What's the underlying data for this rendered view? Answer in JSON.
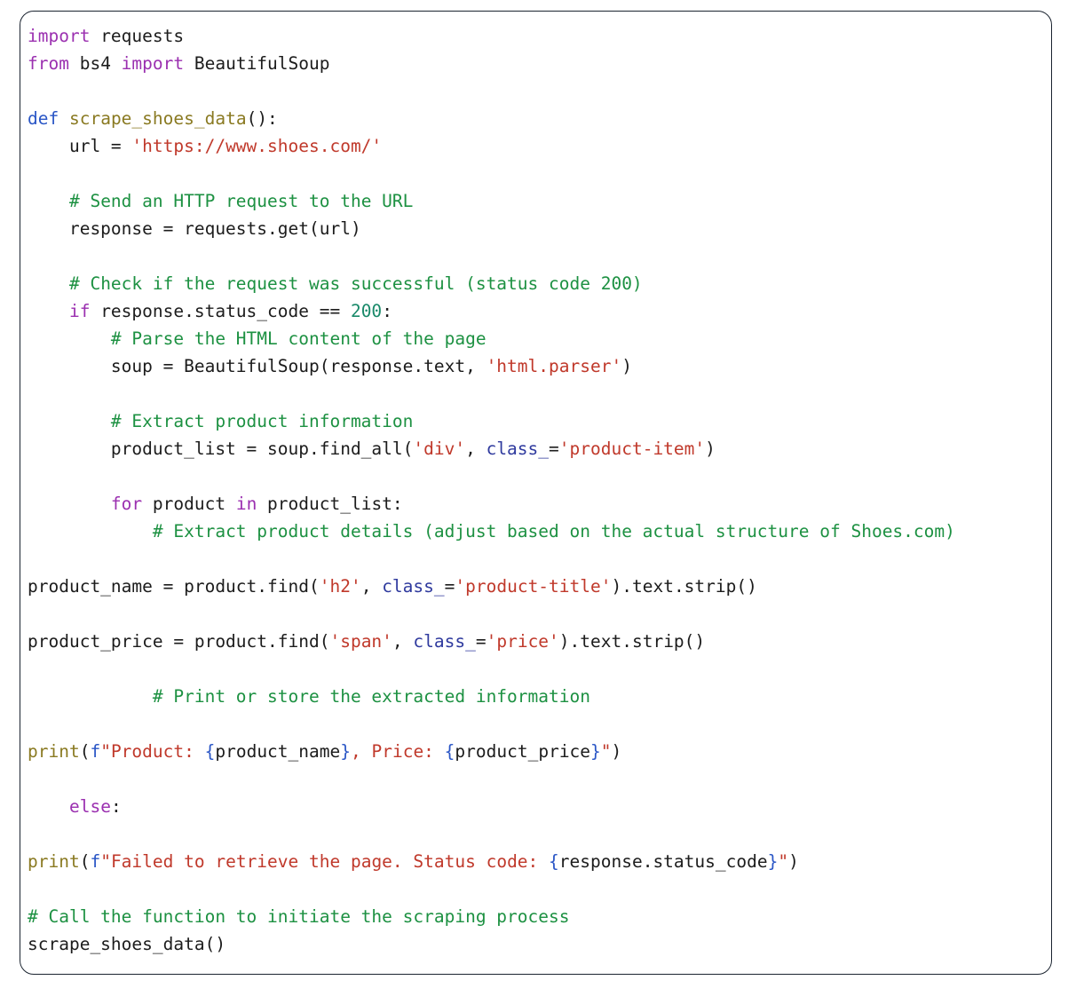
{
  "window": {
    "title": "Python code block",
    "language": "python",
    "border_color": "#1b2430",
    "background_color": "#ffffff"
  },
  "theme": {
    "keyword_color": "#9b30b0",
    "def_keyword_color": "#2a56c6",
    "function_name_color": "#8a7a22",
    "string_color": "#c0392b",
    "number_color": "#1a8a6a",
    "comment_color": "#1d9142",
    "kwarg_color": "#2f3a9e",
    "fstring_brace_color": "#2a56c6",
    "plain_text_color": "#1c1c1c"
  },
  "code": {
    "lines": [
      {
        "n": 1,
        "tokens": [
          {
            "t": "import",
            "c": "kw"
          },
          {
            "t": " requests",
            "c": "plain"
          }
        ]
      },
      {
        "n": 2,
        "tokens": [
          {
            "t": "from",
            "c": "kw"
          },
          {
            "t": " bs4 ",
            "c": "plain"
          },
          {
            "t": "import",
            "c": "kw"
          },
          {
            "t": " BeautifulSoup",
            "c": "plain"
          }
        ]
      },
      {
        "n": 3,
        "tokens": []
      },
      {
        "n": 4,
        "tokens": [
          {
            "t": "def",
            "c": "def"
          },
          {
            "t": " ",
            "c": "plain"
          },
          {
            "t": "scrape_shoes_data",
            "c": "fn"
          },
          {
            "t": "():",
            "c": "plain"
          }
        ]
      },
      {
        "n": 5,
        "tokens": [
          {
            "t": "    url = ",
            "c": "plain"
          },
          {
            "t": "'https://www.shoes.com/'",
            "c": "str"
          }
        ]
      },
      {
        "n": 6,
        "tokens": []
      },
      {
        "n": 7,
        "tokens": [
          {
            "t": "    ",
            "c": "plain"
          },
          {
            "t": "# Send an HTTP request to the URL",
            "c": "cmt"
          }
        ]
      },
      {
        "n": 8,
        "tokens": [
          {
            "t": "    response = requests.get(url)",
            "c": "plain"
          }
        ]
      },
      {
        "n": 9,
        "tokens": []
      },
      {
        "n": 10,
        "tokens": [
          {
            "t": "    ",
            "c": "plain"
          },
          {
            "t": "# Check if the request was successful (status code 200)",
            "c": "cmt"
          }
        ]
      },
      {
        "n": 11,
        "tokens": [
          {
            "t": "    ",
            "c": "plain"
          },
          {
            "t": "if",
            "c": "kw"
          },
          {
            "t": " response.status_code == ",
            "c": "plain"
          },
          {
            "t": "200",
            "c": "num"
          },
          {
            "t": ":",
            "c": "plain"
          }
        ]
      },
      {
        "n": 12,
        "tokens": [
          {
            "t": "        ",
            "c": "plain"
          },
          {
            "t": "# Parse the HTML content of the page",
            "c": "cmt"
          }
        ]
      },
      {
        "n": 13,
        "tokens": [
          {
            "t": "        soup = BeautifulSoup(response.text, ",
            "c": "plain"
          },
          {
            "t": "'html.parser'",
            "c": "str"
          },
          {
            "t": ")",
            "c": "plain"
          }
        ]
      },
      {
        "n": 14,
        "tokens": []
      },
      {
        "n": 15,
        "tokens": [
          {
            "t": "        ",
            "c": "plain"
          },
          {
            "t": "# Extract product information",
            "c": "cmt"
          }
        ]
      },
      {
        "n": 16,
        "tokens": [
          {
            "t": "        product_list = soup.find_all(",
            "c": "plain"
          },
          {
            "t": "'div'",
            "c": "str"
          },
          {
            "t": ", ",
            "c": "plain"
          },
          {
            "t": "class_",
            "c": "kwarg"
          },
          {
            "t": "=",
            "c": "plain"
          },
          {
            "t": "'product-item'",
            "c": "str"
          },
          {
            "t": ")",
            "c": "plain"
          }
        ]
      },
      {
        "n": 17,
        "tokens": []
      },
      {
        "n": 18,
        "tokens": [
          {
            "t": "        ",
            "c": "plain"
          },
          {
            "t": "for",
            "c": "kw"
          },
          {
            "t": " product ",
            "c": "plain"
          },
          {
            "t": "in",
            "c": "kw"
          },
          {
            "t": " product_list:",
            "c": "plain"
          }
        ]
      },
      {
        "n": 19,
        "tokens": [
          {
            "t": "            ",
            "c": "plain"
          },
          {
            "t": "# Extract product details (adjust based on the actual structure of Shoes.com)",
            "c": "cmt"
          }
        ]
      },
      {
        "n": 20,
        "tokens": []
      },
      {
        "n": 21,
        "tokens": [
          {
            "t": "product_name = product.find(",
            "c": "plain"
          },
          {
            "t": "'h2'",
            "c": "str"
          },
          {
            "t": ", ",
            "c": "plain"
          },
          {
            "t": "class_",
            "c": "kwarg"
          },
          {
            "t": "=",
            "c": "plain"
          },
          {
            "t": "'product-title'",
            "c": "str"
          },
          {
            "t": ").text.strip()",
            "c": "plain"
          }
        ]
      },
      {
        "n": 22,
        "tokens": []
      },
      {
        "n": 23,
        "tokens": [
          {
            "t": "product_price = product.find(",
            "c": "plain"
          },
          {
            "t": "'span'",
            "c": "str"
          },
          {
            "t": ", ",
            "c": "plain"
          },
          {
            "t": "class_",
            "c": "kwarg"
          },
          {
            "t": "=",
            "c": "plain"
          },
          {
            "t": "'price'",
            "c": "str"
          },
          {
            "t": ").text.strip()",
            "c": "plain"
          }
        ]
      },
      {
        "n": 24,
        "tokens": []
      },
      {
        "n": 25,
        "tokens": [
          {
            "t": "            ",
            "c": "plain"
          },
          {
            "t": "# Print or store the extracted information",
            "c": "cmt"
          }
        ]
      },
      {
        "n": 26,
        "tokens": []
      },
      {
        "n": 27,
        "tokens": [
          {
            "t": "print",
            "c": "fn"
          },
          {
            "t": "(",
            "c": "plain"
          },
          {
            "t": "f",
            "c": "fprefix"
          },
          {
            "t": "\"Product: ",
            "c": "str"
          },
          {
            "t": "{",
            "c": "brace"
          },
          {
            "t": "product_name",
            "c": "plain"
          },
          {
            "t": "}",
            "c": "brace"
          },
          {
            "t": ", Price: ",
            "c": "str"
          },
          {
            "t": "{",
            "c": "brace"
          },
          {
            "t": "product_price",
            "c": "plain"
          },
          {
            "t": "}",
            "c": "brace"
          },
          {
            "t": "\"",
            "c": "str"
          },
          {
            "t": ")",
            "c": "plain"
          }
        ]
      },
      {
        "n": 28,
        "tokens": []
      },
      {
        "n": 29,
        "tokens": [
          {
            "t": "    ",
            "c": "plain"
          },
          {
            "t": "else",
            "c": "kw"
          },
          {
            "t": ":",
            "c": "plain"
          }
        ]
      },
      {
        "n": 30,
        "tokens": []
      },
      {
        "n": 31,
        "tokens": [
          {
            "t": "print",
            "c": "fn"
          },
          {
            "t": "(",
            "c": "plain"
          },
          {
            "t": "f",
            "c": "fprefix"
          },
          {
            "t": "\"Failed to retrieve the page. Status code: ",
            "c": "str"
          },
          {
            "t": "{",
            "c": "brace"
          },
          {
            "t": "response.status_code",
            "c": "plain"
          },
          {
            "t": "}",
            "c": "brace"
          },
          {
            "t": "\"",
            "c": "str"
          },
          {
            "t": ")",
            "c": "plain"
          }
        ]
      },
      {
        "n": 32,
        "tokens": []
      },
      {
        "n": 33,
        "tokens": [
          {
            "t": "# Call the function to initiate the scraping process",
            "c": "cmt"
          }
        ]
      },
      {
        "n": 34,
        "tokens": [
          {
            "t": "scrape_shoes_data()",
            "c": "plain"
          }
        ]
      }
    ]
  }
}
